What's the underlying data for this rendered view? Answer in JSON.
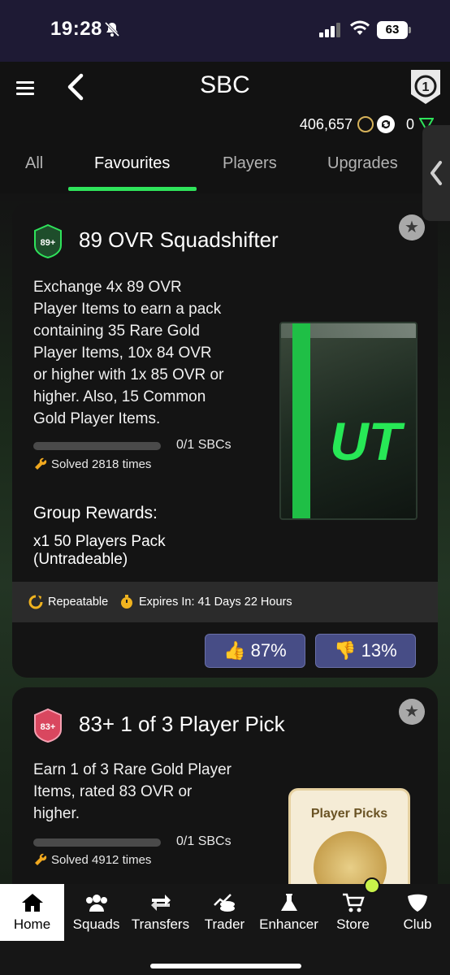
{
  "status_bar": {
    "time": "19:28",
    "battery": "63"
  },
  "header": {
    "title": "SBC",
    "coins": "406,657",
    "points": "0"
  },
  "tabs": [
    "All",
    "Favourites",
    "Players",
    "Upgrades"
  ],
  "active_tab": "Favourites",
  "cards": [
    {
      "badge_text": "89+",
      "title": "89 OVR Squadshifter",
      "description_lines": [
        "Exchange 4x 89 OVR",
        "Player Items to earn a pack",
        "containing 35 Rare Gold",
        "Player Items, 10x 84 OVR",
        "or higher with 1x 85 OVR or",
        "higher. Also, 15 Common",
        "Gold Player Items."
      ],
      "progress_fraction": 0,
      "sbc_count": "0/1 SBCs",
      "solved": "Solved 2818 times",
      "group_rewards_label": "Group Rewards:",
      "group_rewards_value_lines": [
        "x1 50 Players Pack",
        "(Untradeable)"
      ],
      "repeatable": "Repeatable",
      "expires": "Expires In: 41 Days 22 Hours",
      "vote_up": "87%",
      "vote_down": "13%",
      "pack_text": "UT"
    },
    {
      "badge_text": "83+",
      "title": "83+ 1 of 3 Player Pick",
      "description_lines": [
        "Earn 1 of 3 Rare Gold Player",
        "Items, rated 83 OVR or",
        "higher."
      ],
      "progress_fraction": 0,
      "sbc_count": "0/1 SBCs",
      "solved": "Solved 4912 times",
      "pack_text": "Player Picks"
    }
  ],
  "bottom_nav": [
    {
      "label": "Home",
      "icon": "home-icon"
    },
    {
      "label": "Squads",
      "icon": "squads-icon"
    },
    {
      "label": "Transfers",
      "icon": "transfers-icon"
    },
    {
      "label": "Trader",
      "icon": "trader-icon"
    },
    {
      "label": "Enhancer",
      "icon": "enhancer-icon"
    },
    {
      "label": "Store",
      "icon": "store-icon"
    },
    {
      "label": "Club",
      "icon": "club-icon"
    }
  ],
  "colors": {
    "accent": "#2fe35b",
    "vote_bg": "#474d86",
    "header_bg": "#121212",
    "status_bg": "#1e1a34"
  }
}
